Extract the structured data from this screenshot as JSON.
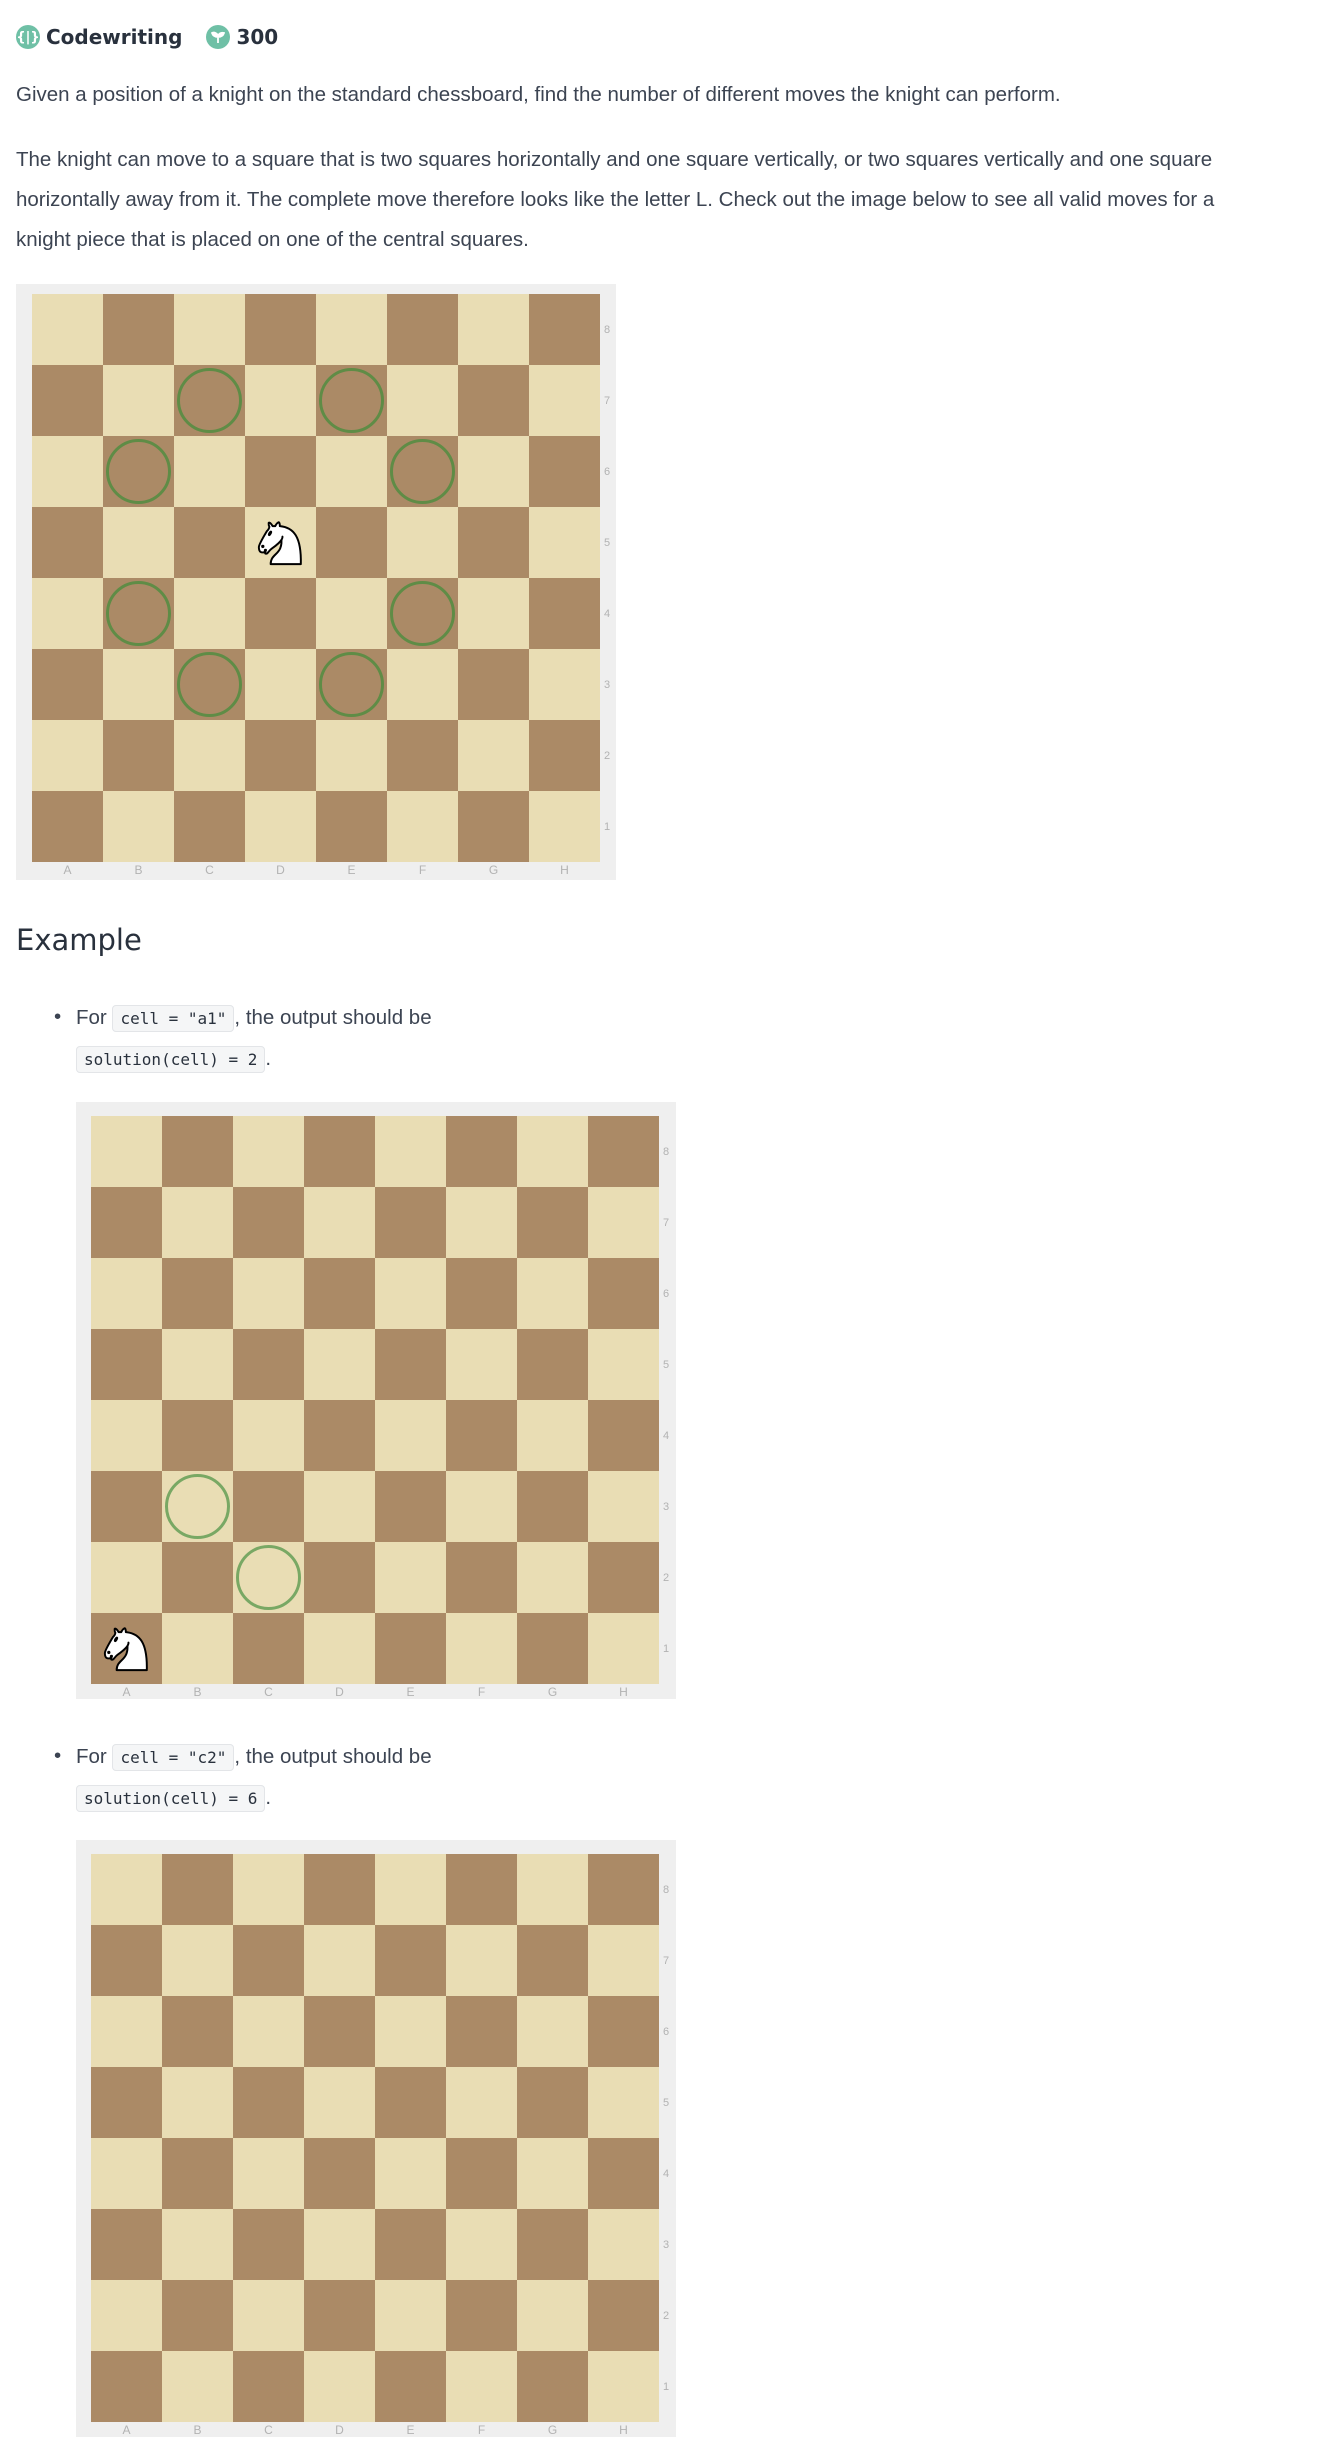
{
  "header": {
    "category_icon": "brain-icon",
    "category": "Codewriting",
    "points_icon": "sprout-icon",
    "points": "300"
  },
  "description": {
    "p1": "Given a position of a knight on the standard chessboard, find the number of different moves the knight can perform.",
    "p2_lines": [
      "The knight can move to a square that is two squares horizontally and one square vertically, or two squares vertically and one square",
      "horizontally away from it. The complete move therefore looks like the letter L. Check out the image below to see all valid moves for a",
      "knight piece that is placed on one of the central squares."
    ]
  },
  "boards": {
    "files": [
      "A",
      "B",
      "C",
      "D",
      "E",
      "F",
      "G",
      "H"
    ],
    "ranks": [
      "8",
      "7",
      "6",
      "5",
      "4",
      "3",
      "2",
      "1"
    ],
    "main": {
      "knight": "d5",
      "moves": [
        "c7",
        "e7",
        "b6",
        "f6",
        "b4",
        "f4",
        "c3",
        "e3"
      ]
    },
    "example1": {
      "knight": "a1",
      "moves": [
        "b3",
        "c2"
      ]
    },
    "example2": {
      "knight": "",
      "moves": []
    }
  },
  "example": {
    "title": "Example",
    "items": [
      {
        "prefix": "For",
        "code_input": "cell = \"a1\"",
        "suffix": ", the output should be",
        "code_output": "solution(cell) = 2",
        "end": "."
      },
      {
        "prefix": "For",
        "code_input": "cell = \"c2\"",
        "suffix": ", the output should be",
        "code_output": "solution(cell) = 6",
        "end": "."
      }
    ]
  },
  "colors": {
    "light_square": "#e9ddb4",
    "dark_square": "#ab8a66",
    "move_ring": "#5f8c46",
    "badge": "#6fc0a6"
  }
}
